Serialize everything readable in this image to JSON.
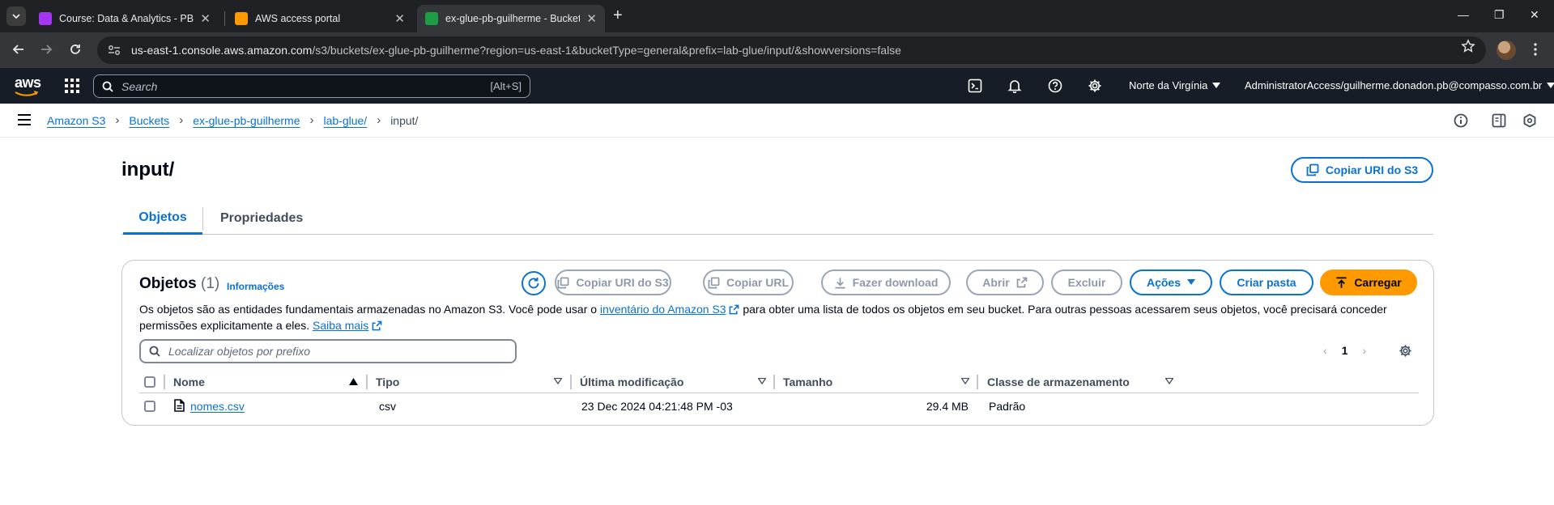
{
  "browser": {
    "tabs": [
      {
        "label": "Course: Data & Analytics - PB -",
        "favicon_color": "#a435f0",
        "active": false
      },
      {
        "label": "AWS access portal",
        "favicon_color": "#ff9900",
        "active": false
      },
      {
        "label": "ex-glue-pb-guilherme - Bucket",
        "favicon_color": "#1b9e44",
        "active": true
      }
    ],
    "url_host": "us-east-1.console.aws.amazon.com",
    "url_path": "/s3/buckets/ex-glue-pb-guilherme?region=us-east-1&bucketType=general&prefix=lab-glue/input/&showversions=false"
  },
  "aws_nav": {
    "logo": "aws",
    "search_placeholder": "Search",
    "search_shortcut": "[Alt+S]",
    "region": "Norte da Virgínia",
    "account": "AdministratorAccess/guilherme.donadon.pb@compasso.com.br"
  },
  "breadcrumbs": [
    {
      "label": "Amazon S3",
      "link": true
    },
    {
      "label": "Buckets",
      "link": true
    },
    {
      "label": "ex-glue-pb-guilherme",
      "link": true
    },
    {
      "label": "lab-glue/",
      "link": true
    },
    {
      "label": "input/",
      "link": false
    }
  ],
  "page": {
    "title": "input/",
    "copy_uri_label": "Copiar URI do S3",
    "tabs": [
      {
        "label": "Objetos",
        "active": true
      },
      {
        "label": "Propriedades",
        "active": false
      }
    ]
  },
  "objects_panel": {
    "title": "Objetos",
    "count": "(1)",
    "info_link": "Informações",
    "desc_part1": "Os objetos são as entidades fundamentais armazenadas no Amazon S3. Você pode usar o ",
    "desc_link1": "inventário do Amazon S3",
    "desc_part2": " para obter uma lista de todos os objetos em seu bucket. Para outras pessoas acessarem seus objetos, você precisará conceder permissões explicitamente a eles. ",
    "desc_link2": "Saiba mais",
    "buttons": {
      "copy_uri": "Copiar URI do S3",
      "copy_url": "Copiar URL",
      "download": "Fazer download",
      "open": "Abrir",
      "delete": "Excluir",
      "actions": "Ações",
      "create_folder": "Criar pasta",
      "upload": "Carregar"
    },
    "filter_placeholder": "Localizar objetos por prefixo",
    "page_number": "1",
    "columns": [
      "Nome",
      "Tipo",
      "Última modificação",
      "Tamanho",
      "Classe de armazenamento"
    ],
    "rows": [
      {
        "name": "nomes.csv",
        "type": "csv",
        "modified": "23 Dec 2024 04:21:48 PM -03",
        "size": "29.4 MB",
        "storage_class": "Padrão"
      }
    ]
  }
}
